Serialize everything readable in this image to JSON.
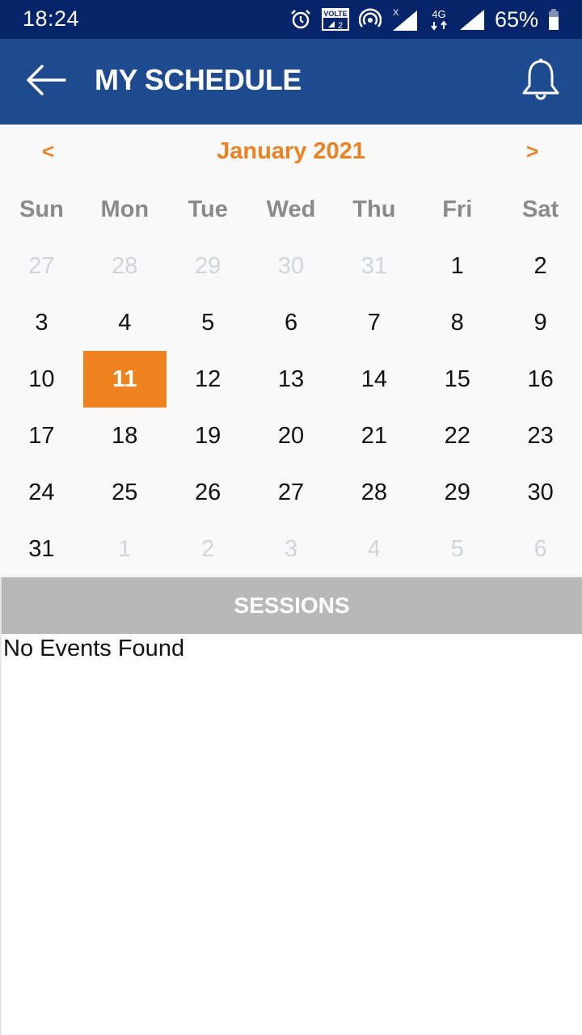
{
  "status_bar": {
    "time": "18:24",
    "icons": [
      "alarm-icon",
      "volte-icon",
      "hotspot-icon",
      "signal-icon",
      "4g-icon",
      "signal-icon",
      "battery-icon"
    ],
    "volte_label": "VOLTE",
    "volte_sim": "2",
    "network_type": "4G",
    "battery": "65%"
  },
  "app_bar": {
    "title": "MY SCHEDULE",
    "back_icon": "arrow-left-icon",
    "notification_icon": "bell-icon"
  },
  "calendar": {
    "prev_label": "<",
    "next_label": ">",
    "month_title": "January 2021",
    "weekdays": [
      "Sun",
      "Mon",
      "Tue",
      "Wed",
      "Thu",
      "Fri",
      "Sat"
    ],
    "days": [
      {
        "label": "27",
        "muted": true
      },
      {
        "label": "28",
        "muted": true
      },
      {
        "label": "29",
        "muted": true
      },
      {
        "label": "30",
        "muted": true
      },
      {
        "label": "31",
        "muted": true
      },
      {
        "label": "1",
        "muted": false
      },
      {
        "label": "2",
        "muted": false
      },
      {
        "label": "3",
        "muted": false
      },
      {
        "label": "4",
        "muted": false
      },
      {
        "label": "5",
        "muted": false
      },
      {
        "label": "6",
        "muted": false
      },
      {
        "label": "7",
        "muted": false
      },
      {
        "label": "8",
        "muted": false
      },
      {
        "label": "9",
        "muted": false
      },
      {
        "label": "10",
        "muted": false
      },
      {
        "label": "11",
        "muted": false,
        "selected": true
      },
      {
        "label": "12",
        "muted": false
      },
      {
        "label": "13",
        "muted": false
      },
      {
        "label": "14",
        "muted": false
      },
      {
        "label": "15",
        "muted": false
      },
      {
        "label": "16",
        "muted": false
      },
      {
        "label": "17",
        "muted": false
      },
      {
        "label": "18",
        "muted": false
      },
      {
        "label": "19",
        "muted": false
      },
      {
        "label": "20",
        "muted": false
      },
      {
        "label": "21",
        "muted": false
      },
      {
        "label": "22",
        "muted": false
      },
      {
        "label": "23",
        "muted": false
      },
      {
        "label": "24",
        "muted": false
      },
      {
        "label": "25",
        "muted": false
      },
      {
        "label": "26",
        "muted": false
      },
      {
        "label": "27",
        "muted": false
      },
      {
        "label": "28",
        "muted": false
      },
      {
        "label": "29",
        "muted": false
      },
      {
        "label": "30",
        "muted": false
      },
      {
        "label": "31",
        "muted": false
      },
      {
        "label": "1",
        "muted": true
      },
      {
        "label": "2",
        "muted": true
      },
      {
        "label": "3",
        "muted": true
      },
      {
        "label": "4",
        "muted": true
      },
      {
        "label": "5",
        "muted": true
      },
      {
        "label": "6",
        "muted": true
      }
    ],
    "selected_day": "11"
  },
  "sessions": {
    "header": "SESSIONS",
    "empty_message": "No Events Found"
  },
  "colors": {
    "status_bar": "#05246a",
    "app_bar": "#1e4a90",
    "accent": "#ee821f",
    "sessions_header": "#b8b8b8"
  }
}
